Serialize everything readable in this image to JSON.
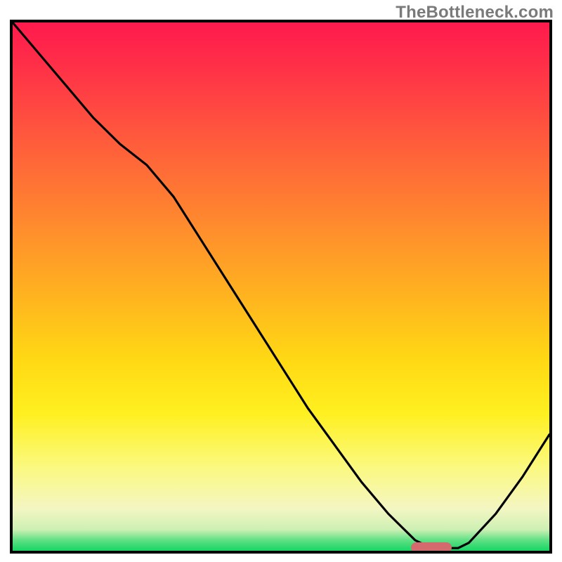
{
  "watermark": "TheBottleneck.com",
  "colors": {
    "border": "#000000",
    "curve": "#000000",
    "marker": "#d46a6d",
    "grad_top": "#ff1a4d",
    "grad_mid": "#ffd914",
    "grad_bot": "#16d664"
  },
  "chart_data": {
    "type": "line",
    "title": "",
    "xlabel": "",
    "ylabel": "",
    "xlim": [
      0,
      100
    ],
    "ylim": [
      0,
      100
    ],
    "grid": false,
    "series": [
      {
        "name": "bottleneck-curve",
        "x": [
          0,
          5,
          10,
          15,
          20,
          25,
          30,
          35,
          40,
          45,
          50,
          55,
          60,
          65,
          70,
          75,
          78,
          80,
          83,
          85,
          90,
          95,
          100
        ],
        "y": [
          100,
          94,
          88,
          82,
          77,
          73,
          67,
          59,
          51,
          43,
          35,
          27,
          20,
          13,
          7,
          2,
          0.5,
          0.5,
          0.5,
          1.5,
          7,
          14,
          22
        ]
      }
    ],
    "marker": {
      "x_pct": 78,
      "y_pct": 0.5,
      "width_pct": 7.5
    },
    "background": "vertical red→yellow→green gradient (green = no bottleneck)"
  }
}
